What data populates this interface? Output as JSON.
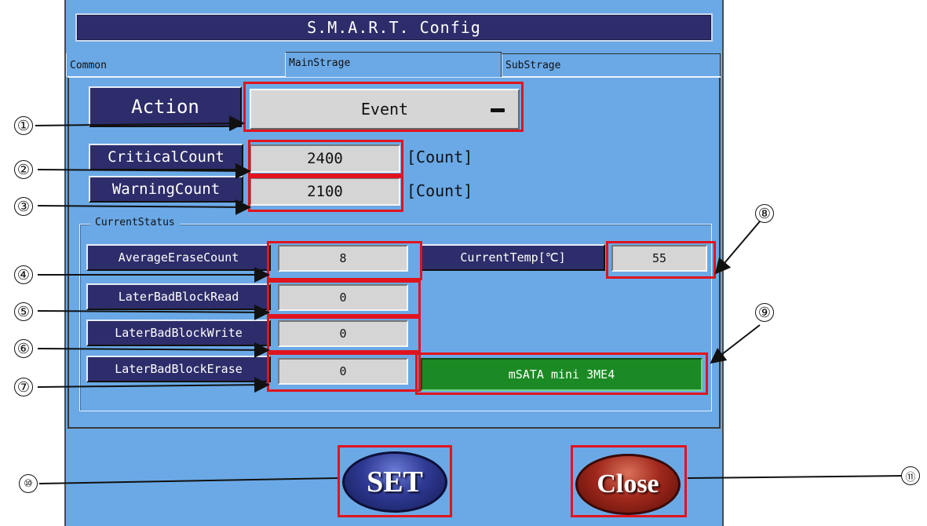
{
  "window": {
    "title": "S.M.A.R.T. Config"
  },
  "tabs": [
    {
      "label": "Common"
    },
    {
      "label": "MainStrage"
    },
    {
      "label": "SubStrage"
    }
  ],
  "action": {
    "label": "Action",
    "value": "Event"
  },
  "critical": {
    "label": "CriticalCount",
    "value": "2400",
    "unit": "[Count]"
  },
  "warning": {
    "label": "WarningCount",
    "value": "2100",
    "unit": "[Count]"
  },
  "status": {
    "caption": "CurrentStatus",
    "average_erase": {
      "label": "AverageEraseCount",
      "value": "8"
    },
    "bad_block_read": {
      "label": "LaterBadBlockRead",
      "value": "0"
    },
    "bad_block_write": {
      "label": "LaterBadBlockWrite",
      "value": "0"
    },
    "bad_block_erase": {
      "label": "LaterBadBlockErase",
      "value": "0"
    },
    "temperature": {
      "label": "CurrentTemp[℃]",
      "value": "55"
    },
    "model": "mSATA mini 3ME4"
  },
  "buttons": {
    "set": "SET",
    "close": "Close"
  },
  "callouts": [
    "①",
    "②",
    "③",
    "④",
    "⑤",
    "⑥",
    "⑦",
    "⑧",
    "⑨",
    "⑩",
    "⑪"
  ],
  "colors": {
    "window_bg": "#6aa9e6",
    "label_bg": "#2d2d6b",
    "field_bg": "#d5d5d5",
    "highlight": "#e0141e",
    "model_badge": "#1b8a24",
    "set_button": "#2e3a94",
    "close_button": "#a0281c"
  }
}
